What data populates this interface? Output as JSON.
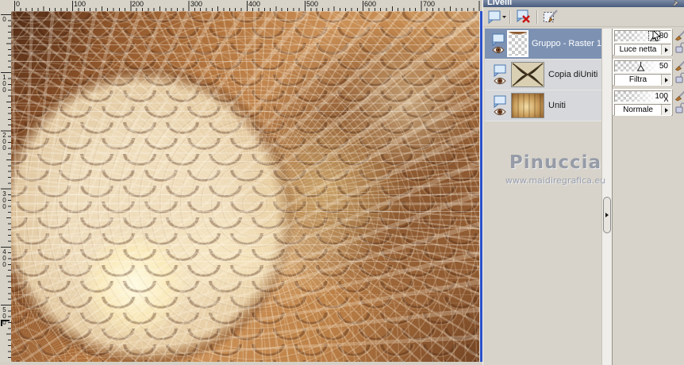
{
  "rulers": {
    "horizontal": [
      "0",
      "100",
      "200",
      "300",
      "400",
      "500",
      "600",
      "700"
    ],
    "vertical": [
      "0",
      "100",
      "200",
      "300",
      "400",
      "500"
    ]
  },
  "layers_panel": {
    "title": "Livelli",
    "toolbar": {
      "new_layer_tooltip": "new-layer",
      "delete_layer_tooltip": "delete-layer",
      "edit_selection_tooltip": "edit-selection"
    },
    "layers": [
      {
        "name": "Gruppo - Raster 1",
        "opacity": "80",
        "blend_mode": "Luce netta",
        "selected": true
      },
      {
        "name": "Copia diUniti",
        "opacity": "50",
        "blend_mode": "Filtra",
        "selected": false
      },
      {
        "name": "Uniti",
        "opacity": "100",
        "blend_mode": "Normale",
        "selected": false
      }
    ]
  },
  "watermark": {
    "line1": "Pinuccia",
    "line2": "www.maidiregrafica.eu"
  },
  "colors": {
    "selected_row": "#7d92b3",
    "panel_background": "#d7d3ca",
    "canvas_border": "#2b50c8",
    "artwork_accent": "#cb9158"
  }
}
